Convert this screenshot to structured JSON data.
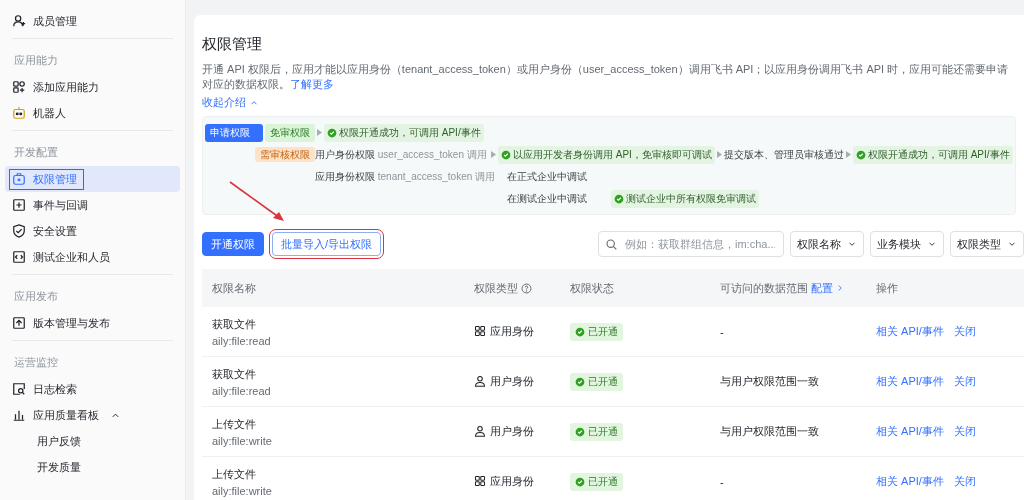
{
  "sidebar": {
    "sections": [
      {
        "items": [
          {
            "label": "成员管理",
            "selected": false,
            "highlighted": false
          }
        ]
      },
      {
        "title": "应用能力",
        "items": [
          {
            "label": "添加应用能力",
            "selected": false,
            "highlighted": false
          },
          {
            "label": "机器人",
            "selected": false,
            "highlighted": false
          }
        ]
      },
      {
        "title": "开发配置",
        "items": [
          {
            "label": "权限管理",
            "selected": true,
            "highlighted": true
          },
          {
            "label": "事件与回调",
            "selected": false,
            "highlighted": false
          },
          {
            "label": "安全设置",
            "selected": false,
            "highlighted": false
          },
          {
            "label": "测试企业和人员",
            "selected": false,
            "highlighted": false
          }
        ]
      },
      {
        "title": "应用发布",
        "items": [
          {
            "label": "版本管理与发布",
            "selected": false,
            "highlighted": false
          }
        ]
      },
      {
        "title": "运营监控",
        "items": [
          {
            "label": "日志检索",
            "selected": false,
            "highlighted": false
          },
          {
            "label": "应用质量看板",
            "selected": false,
            "highlighted": false,
            "expanded": true,
            "children": [
              {
                "label": "用户反馈"
              },
              {
                "label": "开发质量"
              }
            ]
          }
        ]
      }
    ]
  },
  "page": {
    "title": "权限管理",
    "description": "开通 API 权限后，应用才能以应用身份（tenant_access_token）或用户身份（user_access_token）调用飞书 API；以应用身份调用飞书 API 时，应用可能还需要申请对应的数据权限。",
    "learn_more": "了解更多",
    "collapse": "收起介绍",
    "flow_diagram": {
      "start": "申请权限",
      "free": {
        "tag": "免审权限",
        "result": "权限开通成功，可调用 API/事件"
      },
      "review": {
        "tag": "需审核权限",
        "user_identity": {
          "label": "用户身份权限",
          "note": "user_access_token 调用",
          "debug": "以应用开发者身份调用 API，免审核即可调试",
          "step": "提交版本、管理员审核通过",
          "result": "权限开通成功，可调用 API/事件"
        },
        "app_identity": {
          "label": "应用身份权限",
          "note": "tenant_access_token 调用",
          "prod": "在正式企业中调试",
          "test": "在测试企业中调试",
          "test_result": "测试企业中所有权限免审调试"
        }
      }
    },
    "toolbar": {
      "primary_button": "开通权限",
      "secondary_button": {
        "label": "批量导入/导出权限",
        "highlighted": true
      },
      "search": {
        "placeholder": "例如：获取群组信息，im:cha..."
      },
      "filters": [
        "权限名称",
        "业务模块",
        "权限类型"
      ]
    },
    "table": {
      "columns": [
        {
          "label": "权限名称"
        },
        {
          "label": "权限类型",
          "help": true
        },
        {
          "label": "权限状态"
        },
        {
          "label": "可访问的数据范围",
          "link": "配置"
        },
        {
          "label": "操作"
        }
      ],
      "rows": [
        {
          "name": "获取文件",
          "scope": "aily:file:read",
          "type": {
            "kind": "app",
            "label": "应用身份"
          },
          "status": "已开通",
          "data_scope": "-",
          "actions": [
            "相关 API/事件",
            "关闭"
          ]
        },
        {
          "name": "获取文件",
          "scope": "aily:file:read",
          "type": {
            "kind": "user",
            "label": "用户身份"
          },
          "status": "已开通",
          "data_scope": "与用户权限范围一致",
          "actions": [
            "相关 API/事件",
            "关闭"
          ]
        },
        {
          "name": "上传文件",
          "scope": "aily:file:write",
          "type": {
            "kind": "user",
            "label": "用户身份"
          },
          "status": "已开通",
          "data_scope": "与用户权限范围一致",
          "actions": [
            "相关 API/事件",
            "关闭"
          ]
        },
        {
          "name": "上传文件",
          "scope": "aily:file:write",
          "type": {
            "kind": "app",
            "label": "应用身份"
          },
          "status": "已开通",
          "data_scope": "-",
          "actions": [
            "相关 API/事件",
            "关闭"
          ]
        }
      ]
    }
  }
}
